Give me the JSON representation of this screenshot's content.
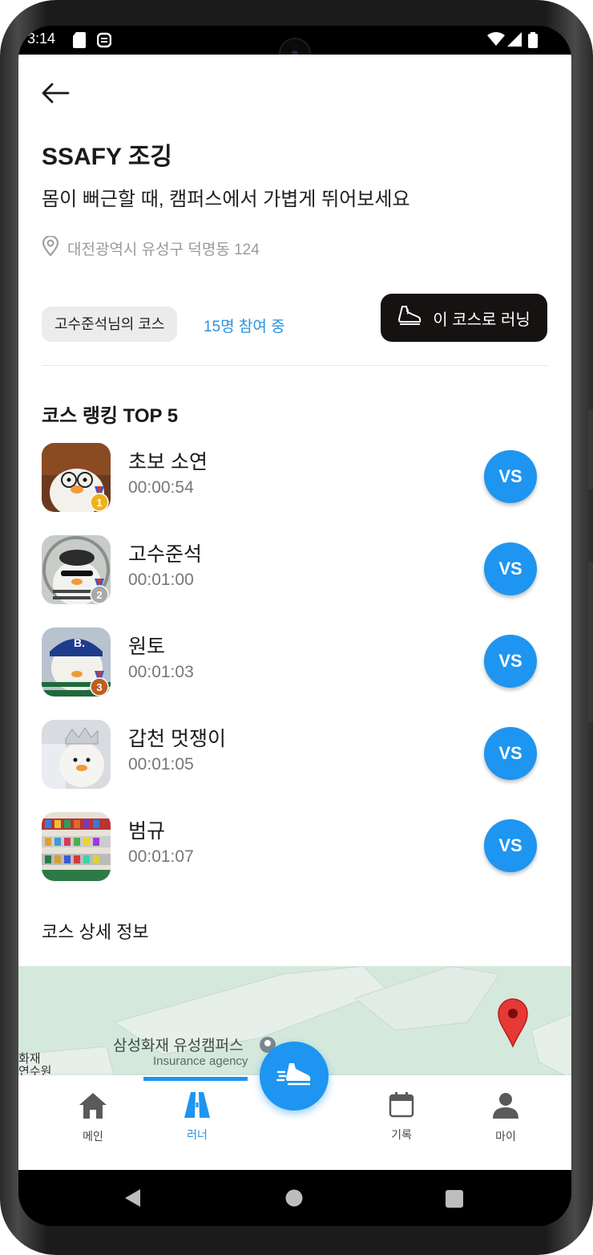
{
  "status_bar": {
    "time": "3:14"
  },
  "header": {
    "title": "SSAFY 조깅",
    "subtitle": "몸이 뻐근할 때, 캠퍼스에서 가볍게 뛰어보세요",
    "location": "대전광역시 유성구 덕명동 124"
  },
  "course": {
    "owner_chip": "고수준석님의 코스",
    "participants": "15명 참여 중",
    "run_button": "이 코스로 러닝"
  },
  "ranking": {
    "title": "코스 랭킹 TOP 5",
    "vs_label": "VS",
    "items": [
      {
        "rank": "1",
        "name": "초보 소연",
        "time": "00:00:54",
        "medal_color": "#f0b21b"
      },
      {
        "rank": "2",
        "name": "고수준석",
        "time": "00:01:00",
        "medal_color": "#a9a9a9"
      },
      {
        "rank": "3",
        "name": "원토",
        "time": "00:01:03",
        "medal_color": "#c15d1f"
      },
      {
        "rank": "",
        "name": "갑천 멋쟁이",
        "time": "00:01:05"
      },
      {
        "rank": "",
        "name": "범규",
        "time": "00:01:07"
      }
    ]
  },
  "detail": {
    "title": "코스 상세 정보",
    "map": {
      "place_name": "삼성화재 유성캠퍼스",
      "place_type": "Insurance agency",
      "edge_text_1": "화재",
      "edge_text_2": "연수원"
    }
  },
  "bottom_nav": {
    "items": [
      {
        "label": "메인",
        "icon": "home-icon"
      },
      {
        "label": "러너",
        "icon": "road-icon",
        "active": true
      },
      {
        "label": "기록",
        "icon": "calendar-icon"
      },
      {
        "label": "마이",
        "icon": "person-icon"
      }
    ],
    "fab_icon": "running-shoe-icon"
  },
  "colors": {
    "accent": "#1e95f0",
    "dark_button": "#161212",
    "participants_text": "#2a92e0"
  }
}
